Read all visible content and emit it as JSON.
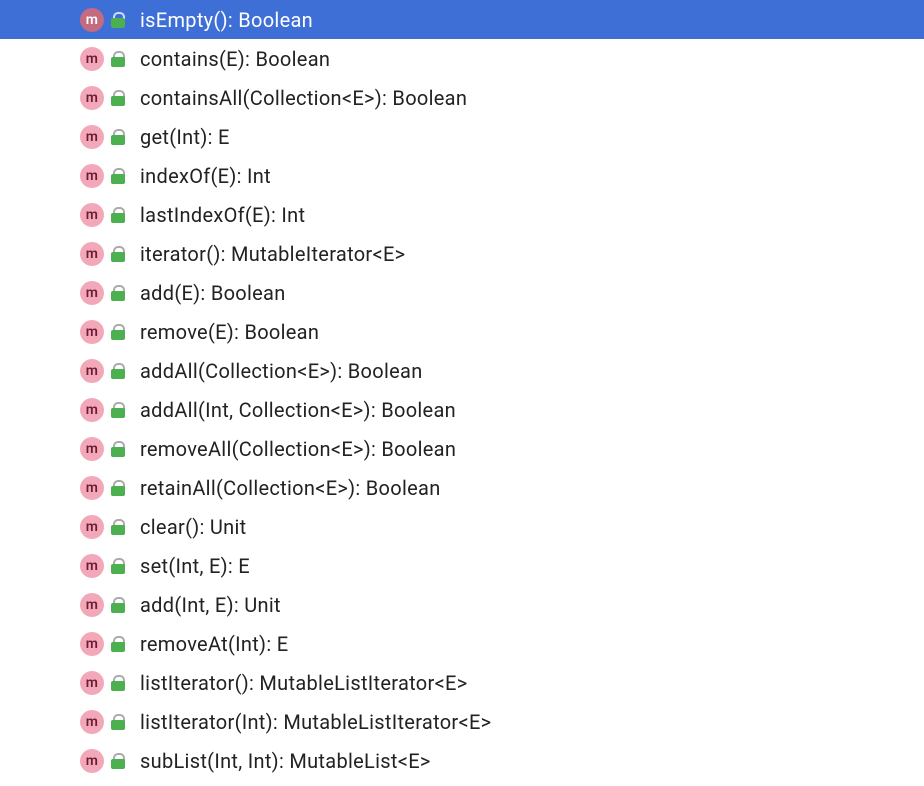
{
  "icon_letter": "m",
  "methods": [
    {
      "signature": "isEmpty(): Boolean",
      "selected": true
    },
    {
      "signature": "contains(E): Boolean",
      "selected": false
    },
    {
      "signature": "containsAll(Collection<E>): Boolean",
      "selected": false
    },
    {
      "signature": "get(Int): E",
      "selected": false
    },
    {
      "signature": "indexOf(E): Int",
      "selected": false
    },
    {
      "signature": "lastIndexOf(E): Int",
      "selected": false
    },
    {
      "signature": "iterator(): MutableIterator<E>",
      "selected": false
    },
    {
      "signature": "add(E): Boolean",
      "selected": false
    },
    {
      "signature": "remove(E): Boolean",
      "selected": false
    },
    {
      "signature": "addAll(Collection<E>): Boolean",
      "selected": false
    },
    {
      "signature": "addAll(Int, Collection<E>): Boolean",
      "selected": false
    },
    {
      "signature": "removeAll(Collection<E>): Boolean",
      "selected": false
    },
    {
      "signature": "retainAll(Collection<E>): Boolean",
      "selected": false
    },
    {
      "signature": "clear(): Unit",
      "selected": false
    },
    {
      "signature": "set(Int, E): E",
      "selected": false
    },
    {
      "signature": "add(Int, E): Unit",
      "selected": false
    },
    {
      "signature": "removeAt(Int): E",
      "selected": false
    },
    {
      "signature": "listIterator(): MutableListIterator<E>",
      "selected": false
    },
    {
      "signature": "listIterator(Int): MutableListIterator<E>",
      "selected": false
    },
    {
      "signature": "subList(Int, Int): MutableList<E>",
      "selected": false
    }
  ]
}
